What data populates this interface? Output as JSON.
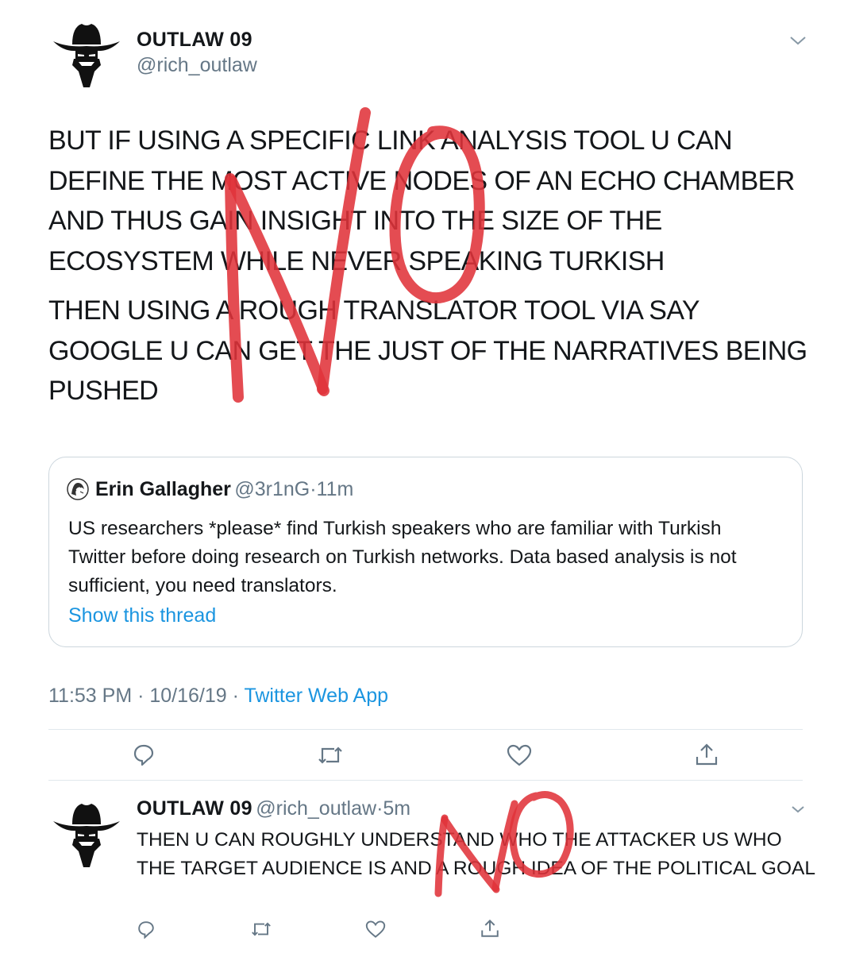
{
  "main_tweet": {
    "name": "OUTLAW 09",
    "handle": "@rich_outlaw",
    "paragraphs": [
      "BUT IF USING A SPECIFIC LINK ANALYSIS TOOL U CAN DEFINE THE MOST ACTIVE NODES OF AN ECHO CHAMBER AND THUS GAIN INSIGHT INTO THE SIZE OF THE ECOSYSTEM WHILE NEVER SPEAKING TURKISH",
      "THEN USING A ROUGH TRANSLATOR TOOL VIA SAY GOOGLE U CAN GET THE JUST OF THE NARRATIVES BEING PUSHED"
    ],
    "quote": {
      "name": "Erin Gallagher",
      "handle": "@3r1nG",
      "sep": "·",
      "time": "11m",
      "text": "US researchers *please* find Turkish speakers who are familiar with Turkish Twitter before doing research on Turkish networks. Data based analysis is not sufficient, you need translators.",
      "link": "Show this thread"
    },
    "timestamp": "11:53 PM · 10/16/19 · ",
    "source": "Twitter Web App"
  },
  "reply_tweet": {
    "name": "OUTLAW 09",
    "handle": "@rich_outlaw",
    "sep": "·",
    "time": "5m",
    "text": "THEN U CAN ROUGHLY UNDERSTAND WHO THE ATTACKER US WHO THE TARGET AUDIENCE IS AND A ROUGH IDEA OF THE POLITICAL GOAL"
  },
  "icons": {
    "avatar": "outlaw-cowboy-avatar-icon",
    "quote_avatar": "erin-avatar-icon",
    "menu": "chevron-down-icon",
    "reply": "reply-icon",
    "retweet": "retweet-icon",
    "like": "heart-icon",
    "share": "share-icon"
  },
  "colors": {
    "accent": "#1b95e0",
    "annotation": "#e0333a",
    "secondary_text": "#657786"
  }
}
